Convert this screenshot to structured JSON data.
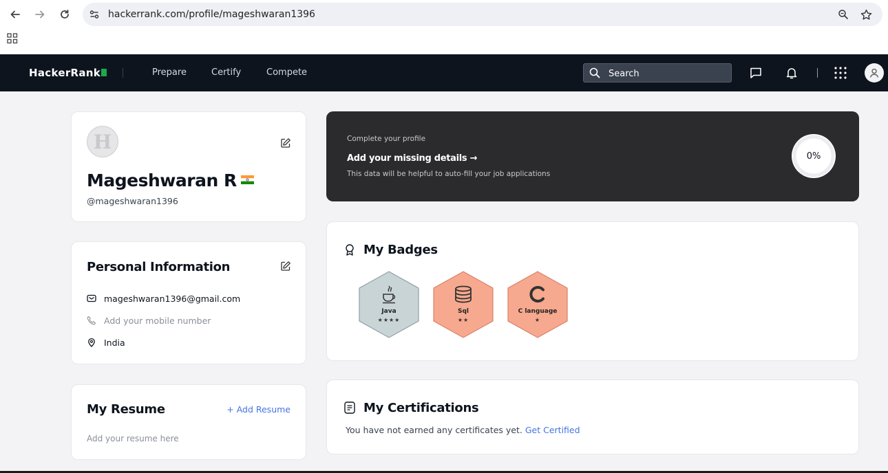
{
  "browser": {
    "url": "hackerrank.com/profile/mageshwaran1396"
  },
  "header": {
    "logo_text": "HackerRank",
    "nav": [
      "Prepare",
      "Certify",
      "Compete"
    ],
    "search_label": "Search"
  },
  "profile": {
    "name": "Mageshwaran R",
    "handle": "@mageshwaran1396",
    "avatar_letter": "H"
  },
  "banner": {
    "kicker": "Complete your profile",
    "title": "Add your missing details →",
    "subtitle": "This data will be helpful to auto-fill your job applications",
    "progress_label": "0%",
    "progress_value": 0
  },
  "personal_info": {
    "title": "Personal Information",
    "email": "mageshwaran1396@gmail.com",
    "phone_placeholder": "Add your mobile number",
    "location": "India"
  },
  "badges": {
    "title": "My Badges",
    "items": [
      {
        "name": "Java",
        "stars": "★★★★",
        "star_count": 4,
        "color": "#c7d3d6",
        "icon": "java-cup-icon"
      },
      {
        "name": "Sql",
        "stars": "★★",
        "star_count": 2,
        "color": "#f6a98e",
        "icon": "database-icon"
      },
      {
        "name": "C language",
        "stars": "★",
        "star_count": 1,
        "color": "#f6a98e",
        "icon": "c-letter-icon"
      }
    ]
  },
  "resume": {
    "title": "My Resume",
    "add_label": "+ Add Resume",
    "hint": "Add your resume here"
  },
  "certifications": {
    "title": "My Certifications",
    "empty_text": "You have not earned any certificates yet.",
    "link_text": "Get Certified"
  },
  "colors": {
    "header_bg": "#0e141e",
    "accent_green": "#1ba94c",
    "link_blue": "#4474e0",
    "banner_bg": "#2b2b2e"
  }
}
